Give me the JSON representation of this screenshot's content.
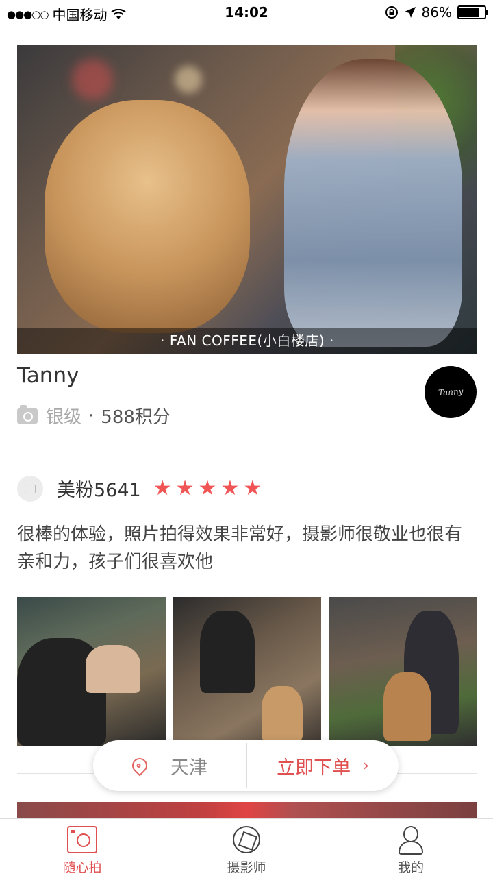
{
  "status_bar": {
    "signal_dots": "●●●○○",
    "carrier": "中国移动",
    "wifi_icon": "wifi-icon",
    "time": "14:02",
    "lock_icon": "orientation-lock-icon",
    "location_icon": "location-arrow-icon",
    "battery_percent": "86%",
    "battery_level": 0.86
  },
  "hero": {
    "caption": "· FAN COFFEE(小白楼店) ·"
  },
  "photographer": {
    "name": "Tanny",
    "avatar_signature": "Tanny",
    "level": "银级",
    "separator": "·",
    "points": "588积分"
  },
  "review": {
    "reviewer_name": "美粉5641",
    "rating": 5,
    "stars": [
      "★",
      "★",
      "★",
      "★",
      "★"
    ],
    "text": "很棒的体验，照片拍得效果非常好，摄影师很敬业也很有亲和力，孩子们很喜欢他"
  },
  "floating_bar": {
    "city": "天津",
    "order_label": "立即下单",
    "chevron": "›"
  },
  "tab_bar": {
    "tabs": [
      {
        "label": "随心拍",
        "icon": "camera-icon",
        "active": true
      },
      {
        "label": "摄影师",
        "icon": "aperture-icon",
        "active": false
      },
      {
        "label": "我的",
        "icon": "user-icon",
        "active": false
      }
    ]
  },
  "colors": {
    "accent": "#e05050",
    "star": "#f05454",
    "muted": "#aaaaaa"
  }
}
